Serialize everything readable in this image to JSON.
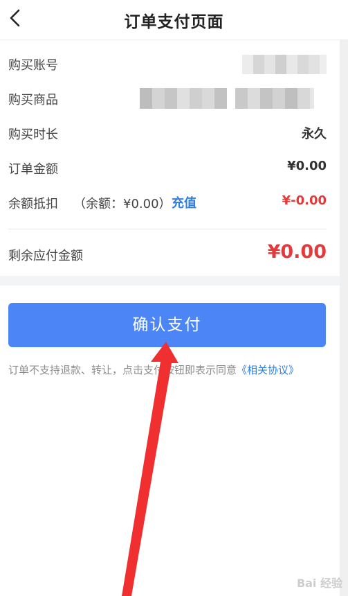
{
  "header": {
    "title": "订单支付页面"
  },
  "rows": {
    "account": {
      "label": "购买账号"
    },
    "product": {
      "label": "购买商品"
    },
    "duration": {
      "label": "购买时长",
      "value": "永久"
    },
    "amount": {
      "label": "订单金额",
      "value": "¥0.00"
    },
    "balance": {
      "label": "余额抵扣",
      "note": "（余额：¥0.00）",
      "recharge": "充值",
      "value": "¥-0.00"
    },
    "remaining": {
      "label": "剩余应付金额",
      "value": "¥0.00"
    }
  },
  "confirm_button": {
    "label": "确认支付"
  },
  "notice": {
    "text": "订单不支持退款、转让，点击支付按钮即表示同意",
    "link": "《相关协议》"
  },
  "watermark": {
    "text": "Bai 经验"
  },
  "colors": {
    "accent_blue": "#4c86f6",
    "link_blue": "#2f7fe0",
    "price_red": "#e33b3b",
    "annotation_arrow": "#f03030"
  }
}
